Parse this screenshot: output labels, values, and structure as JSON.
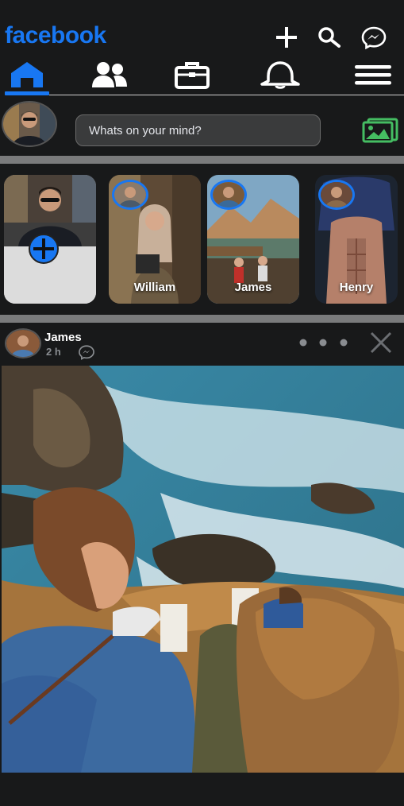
{
  "header": {
    "brand": "facebook",
    "icons": [
      "plus-icon",
      "search-icon",
      "messenger-icon"
    ]
  },
  "nav": {
    "tabs": [
      {
        "name": "home",
        "icon": "home-icon",
        "active": true
      },
      {
        "name": "friends",
        "icon": "friends-icon",
        "active": false
      },
      {
        "name": "marketplace",
        "icon": "briefcase-icon",
        "active": false
      },
      {
        "name": "notifications",
        "icon": "bell-icon",
        "active": false
      },
      {
        "name": "menu",
        "icon": "menu-icon",
        "active": false
      }
    ]
  },
  "composer": {
    "placeholder": "Whats on your mind?",
    "photo_icon": "photo-icon"
  },
  "stories": [
    {
      "name": "",
      "type": "create",
      "icon": "plus-circle-icon"
    },
    {
      "name": "William"
    },
    {
      "name": "James"
    },
    {
      "name": "Henry"
    }
  ],
  "post": {
    "author": "James",
    "time": "2 h",
    "more_icon": "more-dots-icon",
    "close_icon": "close-icon"
  },
  "colors": {
    "accent": "#1877f2",
    "background": "#18191a",
    "photo_icon": "#45bd62"
  }
}
